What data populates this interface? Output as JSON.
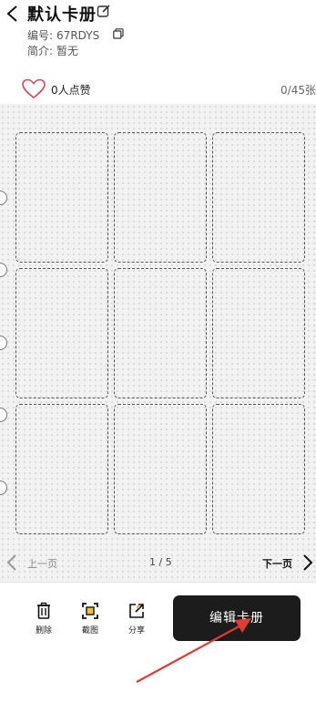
{
  "header": {
    "title": "默认卡册",
    "code_label": "编号:",
    "code_value": "67RDYS",
    "intro_label": "简介:",
    "intro_value": "暂无"
  },
  "likes": {
    "label": "0人点赞",
    "card_count": "0/45张"
  },
  "pager": {
    "prev_label": "上一页",
    "page_indicator": "1 / 5",
    "next_label": "下一页"
  },
  "toolbar": {
    "delete_label": "删除",
    "screenshot_label": "截图",
    "share_label": "分享",
    "edit_album_label": "编辑卡册"
  },
  "colors": {
    "accent_arrow": "#e53935",
    "primary_button": "#1c1c1c",
    "heart_outline": "#d9455f"
  },
  "icons": [
    "back-icon",
    "edit-pencil-icon",
    "copy-icon",
    "heart-icon",
    "chevron-left-icon",
    "chevron-right-icon",
    "trash-icon",
    "screenshot-icon",
    "share-icon"
  ]
}
